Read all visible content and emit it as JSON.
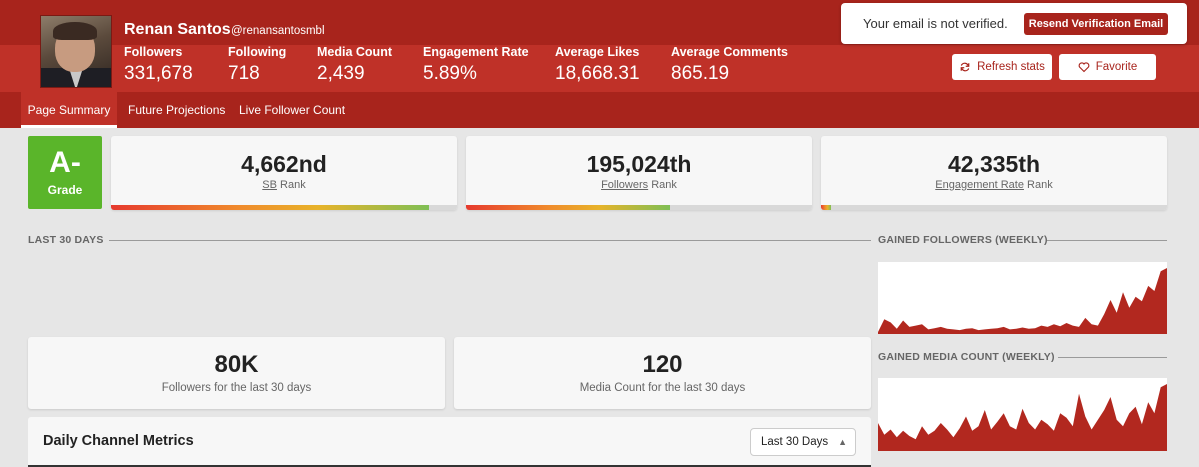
{
  "profile": {
    "name": "Renan Santos",
    "handle": "@renansantosmbl"
  },
  "stats": [
    {
      "label": "Followers",
      "value": "331,678"
    },
    {
      "label": "Following",
      "value": "718"
    },
    {
      "label": "Media Count",
      "value": "2,439"
    },
    {
      "label": "Engagement Rate",
      "value": "5.89%"
    },
    {
      "label": "Average Likes",
      "value": "18,668.31"
    },
    {
      "label": "Average Comments",
      "value": "865.19"
    }
  ],
  "email_banner": {
    "message": "Your email is not verified.",
    "button": "Resend Verification Email"
  },
  "actions": {
    "refresh": "Refresh stats",
    "favorite": "Favorite"
  },
  "tabs": [
    {
      "label": "Page Summary",
      "active": true
    },
    {
      "label": "Future Projections",
      "active": false
    },
    {
      "label": "Live Follower Count",
      "active": false
    }
  ],
  "grade": {
    "value": "A-",
    "label": "Grade",
    "color": "#5ab52a"
  },
  "ranks": [
    {
      "value": "4,662nd",
      "link": "SB",
      "suffix": "Rank",
      "progress": 0.92
    },
    {
      "value": "195,024th",
      "link": "Followers",
      "suffix": "Rank",
      "progress": 0.59
    },
    {
      "value": "42,335th",
      "link": "Engagement Rate",
      "suffix": "Rank",
      "progress": 0.03
    }
  ],
  "sections": {
    "last_30": "LAST 30 DAYS",
    "gained_followers": "GAINED FOLLOWERS (WEEKLY)",
    "gained_media": "GAINED MEDIA COUNT (WEEKLY)"
  },
  "summary_cards": [
    {
      "value": "80K",
      "label": "Followers for the last 30 days"
    },
    {
      "value": "120",
      "label": "Media Count for the last 30 days"
    }
  ],
  "metrics": {
    "title": "Daily Channel Metrics",
    "range_selected": "Last 30 Days"
  },
  "colors": {
    "brand": "#a8241c",
    "brand_light": "#bf3128",
    "chart_fill": "#b2281f"
  },
  "followers_series": [
    0,
    0.2,
    0.15,
    0.05,
    0.18,
    0.08,
    0.1,
    0.12,
    0.04,
    0.06,
    0.08,
    0.05,
    0.04,
    0.03,
    0.05,
    0.06,
    0.03,
    0.04,
    0.05,
    0.06,
    0.08,
    0.04,
    0.05,
    0.07,
    0.05,
    0.06,
    0.1,
    0.08,
    0.12,
    0.09,
    0.14,
    0.1,
    0.08,
    0.22,
    0.12,
    0.1,
    0.28,
    0.5,
    0.3,
    0.62,
    0.38,
    0.55,
    0.48,
    0.72,
    0.64,
    0.95,
    1.0
  ],
  "media_series": [
    0.4,
    0.22,
    0.3,
    0.18,
    0.28,
    0.2,
    0.15,
    0.35,
    0.22,
    0.28,
    0.4,
    0.3,
    0.18,
    0.32,
    0.5,
    0.28,
    0.35,
    0.6,
    0.3,
    0.42,
    0.55,
    0.35,
    0.3,
    0.62,
    0.4,
    0.3,
    0.45,
    0.38,
    0.28,
    0.55,
    0.48,
    0.35,
    0.85,
    0.5,
    0.3,
    0.45,
    0.6,
    0.8,
    0.45,
    0.35,
    0.55,
    0.65,
    0.38,
    0.72,
    0.55,
    0.95,
    1.0
  ]
}
